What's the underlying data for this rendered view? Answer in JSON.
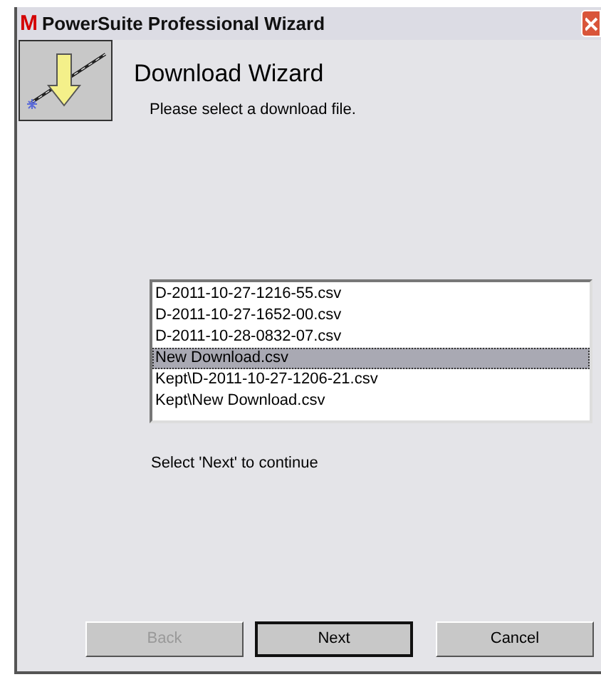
{
  "window": {
    "logo": "M",
    "title": "PowerSuite Professional Wizard"
  },
  "header": {
    "title": "Download Wizard",
    "subtitle": "Please select a download file."
  },
  "files": [
    {
      "name": "D-2011-10-27-1216-55.csv",
      "selected": false
    },
    {
      "name": "D-2011-10-27-1652-00.csv",
      "selected": false
    },
    {
      "name": "D-2011-10-28-0832-07.csv",
      "selected": false
    },
    {
      "name": "New Download.csv",
      "selected": true
    },
    {
      "name": "Kept\\D-2011-10-27-1206-21.csv",
      "selected": false
    },
    {
      "name": "Kept\\New Download.csv",
      "selected": false
    }
  ],
  "hint": "Select 'Next' to continue",
  "buttons": [
    {
      "label": "Back",
      "disabled": true,
      "default": false
    },
    {
      "label": "Next",
      "disabled": false,
      "default": true
    },
    {
      "label": "Cancel",
      "disabled": false,
      "default": false
    }
  ]
}
